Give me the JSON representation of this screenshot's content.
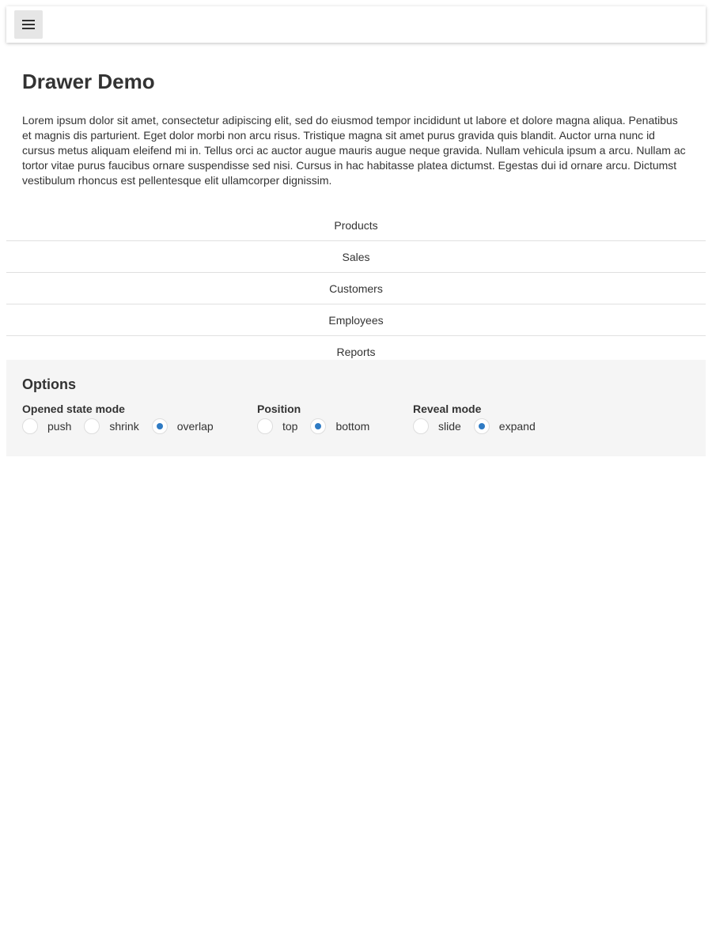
{
  "toolbar": {
    "menu_icon": "hamburger-icon"
  },
  "page": {
    "title": "Drawer Demo",
    "paragraph": "Lorem ipsum dolor sit amet, consectetur adipiscing elit, sed do eiusmod tempor incididunt ut labore et dolore magna aliqua. Penatibus et magnis dis parturient. Eget dolor morbi non arcu risus. Tristique magna sit amet purus gravida quis blandit. Auctor urna nunc id cursus metus aliquam eleifend mi in. Tellus orci ac auctor augue mauris augue neque gravida. Nullam vehicula ipsum a arcu. Nullam ac tortor vitae purus faucibus ornare suspendisse sed nisi. Cursus in hac habitasse platea dictumst. Egestas dui id ornare arcu. Dictumst vestibulum rhoncus est pellentesque elit ullamcorper dignissim."
  },
  "drawer": {
    "items": [
      {
        "label": "Products"
      },
      {
        "label": "Sales"
      },
      {
        "label": "Customers"
      },
      {
        "label": "Employees"
      },
      {
        "label": "Reports"
      }
    ]
  },
  "options": {
    "title": "Options",
    "accent_color": "#2f7bc4",
    "groups": [
      {
        "label": "Opened state mode",
        "options": [
          {
            "label": "push",
            "checked": false
          },
          {
            "label": "shrink",
            "checked": false
          },
          {
            "label": "overlap",
            "checked": true
          }
        ]
      },
      {
        "label": "Position",
        "options": [
          {
            "label": "top",
            "checked": false
          },
          {
            "label": "bottom",
            "checked": true
          }
        ]
      },
      {
        "label": "Reveal mode",
        "options": [
          {
            "label": "slide",
            "checked": false
          },
          {
            "label": "expand",
            "checked": true
          }
        ]
      }
    ]
  }
}
